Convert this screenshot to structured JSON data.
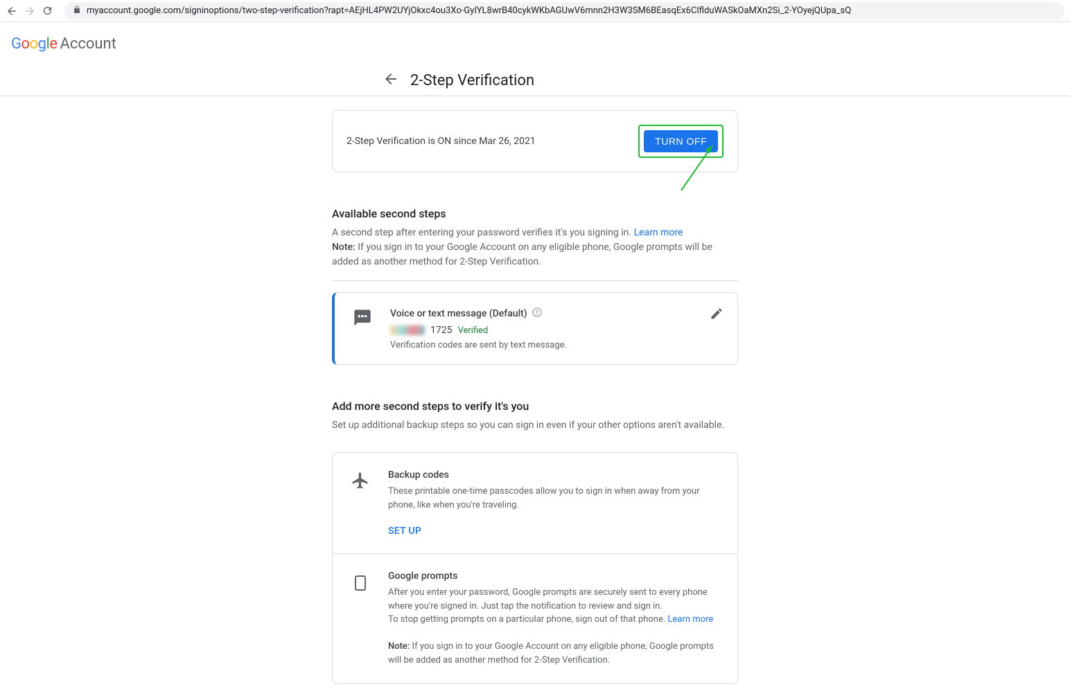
{
  "browser": {
    "url": "myaccount.google.com/signinoptions/two-step-verification?rapt=AEjHL4PW2UYjOkxc4ou3Xo-GyIYL8wrB40cykWKbAGUwV6mnn2H3W3SM6BEasqEx6ClflduWASkOaMXn2Si_2-YOyejQUpa_sQ"
  },
  "header": {
    "account_word": "Account"
  },
  "page": {
    "title": "2-Step Verification"
  },
  "status": {
    "text": "2-Step Verification is ON since Mar 26, 2021",
    "button": "TURN OFF"
  },
  "available": {
    "title": "Available second steps",
    "desc": "A second step after entering your password verifies it's you signing in. ",
    "learn_more": "Learn more",
    "note_label": "Note:",
    "note_text": " If you sign in to your Google Account on any eligible phone, Google prompts will be added as another method for 2-Step Verification."
  },
  "method": {
    "title": "Voice or text message (Default)",
    "value_suffix": "1725",
    "verified": "Verified",
    "note": "Verification codes are sent by text message."
  },
  "addmore": {
    "title": "Add more second steps to verify it's you",
    "desc": "Set up additional backup steps so you can sign in even if your other options aren't available."
  },
  "backup": {
    "title": "Backup codes",
    "desc": "These printable one-time passcodes allow you to sign in when away from your phone, like when you're traveling.",
    "action": "SET UP"
  },
  "prompts": {
    "title": "Google prompts",
    "desc1": "After you enter your password, Google prompts are securely sent to every phone where you're signed in. Just tap the notification to review and sign in.",
    "desc2": "To stop getting prompts on a particular phone, sign out of that phone. ",
    "learn_more": "Learn more",
    "note_label": "Note:",
    "note_text": " If you sign in to your Google Account on any eligible phone, Google prompts will be added as another method for 2-Step Verification."
  }
}
